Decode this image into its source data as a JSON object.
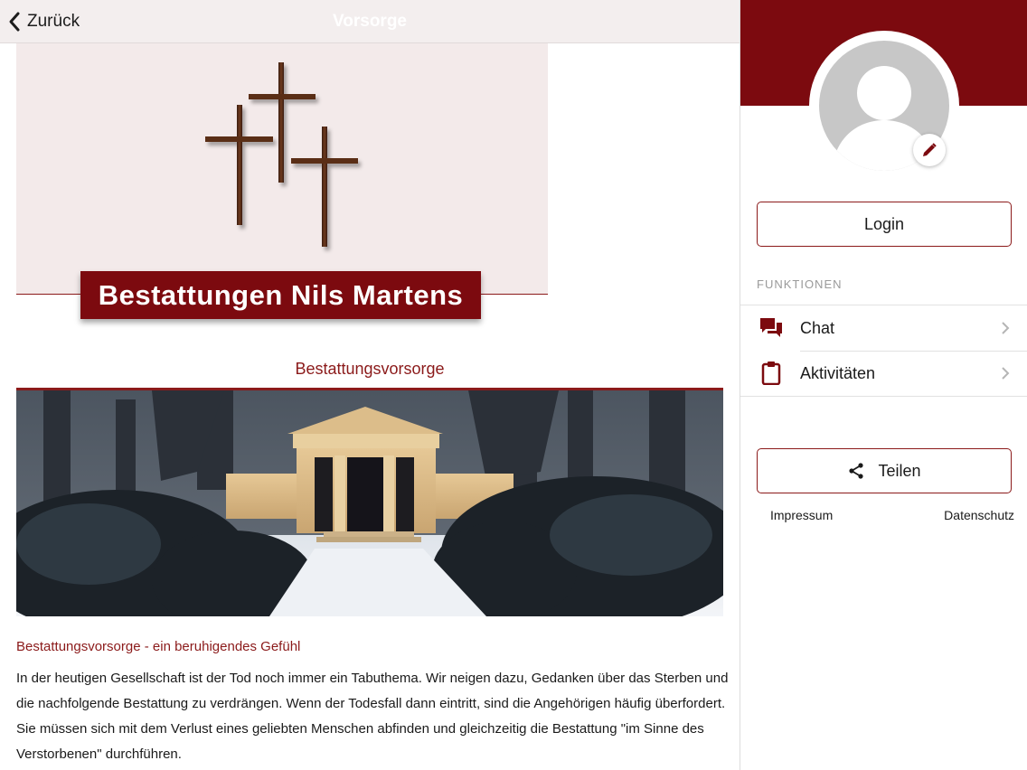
{
  "topbar": {
    "back_label": "Zurück",
    "title": "Vorsorge"
  },
  "hero": {
    "company_name": "Bestattungen Nils Martens"
  },
  "content": {
    "section_title": "Bestattungsvorsorge",
    "sub_heading": "Bestattungsvorsorge - ein beruhigendes Gefühl",
    "paragraph": "In der heutigen Gesellschaft ist der Tod noch immer ein Tabuthema. Wir neigen dazu, Gedanken über das Sterben und die nachfolgende Bestattung zu verdrängen. Wenn der Todesfall dann eintritt, sind die Angehörigen häufig überfordert. Sie müssen sich mit dem Verlust eines geliebten Menschen abfinden und gleichzeitig die Bestattung \"im Sinne des Verstorbenen\" durchführen."
  },
  "sidebar": {
    "login_label": "Login",
    "functions_label": "FUNKTIONEN",
    "menu": [
      {
        "label": "Chat",
        "icon": "chat-icon"
      },
      {
        "label": "Aktivitäten",
        "icon": "clipboard-icon"
      }
    ],
    "share_label": "Teilen",
    "impressum_label": "Impressum",
    "datenschutz_label": "Datenschutz"
  },
  "colors": {
    "brand": "#7c0a0f",
    "accent_text": "#8b1a1a",
    "topbar_bg": "#f3eeee",
    "hero_bg": "#f3eaea"
  }
}
